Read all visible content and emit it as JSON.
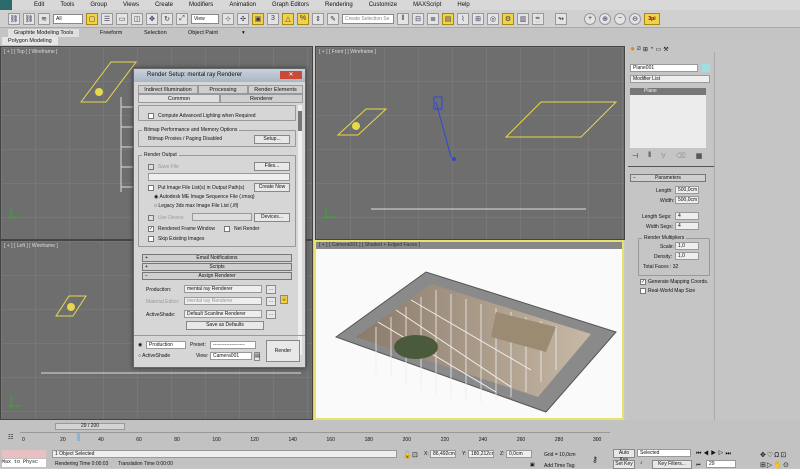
{
  "menu": [
    "Edit",
    "Tools",
    "Group",
    "Views",
    "Create",
    "Modifiers",
    "Animation",
    "Graph Editors",
    "Rendering",
    "Customize",
    "MAXScript",
    "Help"
  ],
  "toolbar": {
    "filter": "All",
    "ref_coord": "View",
    "selection_set_placeholder": "Create Selection Se",
    "logo": "3pi"
  },
  "ribbon": {
    "tabs": [
      "Graphite Modeling Tools",
      "Freeform",
      "Selection",
      "Object Paint"
    ],
    "sub": "Polygon Modeling"
  },
  "viewports": {
    "top": "[ + ] [ Top ] [ Wireframe ]",
    "front": "[ + ] [ Front ] [ Wireframe ]",
    "left": "[ + ] [ Left ] [ Wireframe ]",
    "camera": "[ + ] [ Camera001 ] [ Shaded + Edged Faces ]"
  },
  "dialog": {
    "title": "Render Setup: mental ray Renderer",
    "tabs_row1": [
      "Indirect Illumination",
      "Processing",
      "Render Elements"
    ],
    "tabs_row2": [
      "Common",
      "Renderer"
    ],
    "compute_adv_lighting": "Compute Advanced Lighting when Required",
    "bitmap_group": "Bitmap Performance and Memory Options",
    "bitmap_proxies": "Bitmap Proxies / Paging Disabled",
    "setup": "Setup...",
    "render_output": "Render Output",
    "save_file": "Save File",
    "files": "Files...",
    "put_image": "Put Image File List(s) in Output Path(s)",
    "create_now": "Create Now",
    "autodesk_me": "Autodesk ME Image Sequence File (.imsq)",
    "legacy": "Legacy 3ds max Image File List (.ifl)",
    "use_device": "Use Device",
    "devices": "Devices...",
    "rendered_frame_window": "Rendered Frame Window",
    "net_render": "Net Render",
    "skip_existing": "Skip Existing Images",
    "rollouts": [
      "Email Notifications",
      "Scripts",
      "Assign Renderer"
    ],
    "production_label": "Production:",
    "production_value": "mental ray Renderer",
    "material_label": "Material Editor:",
    "material_value": "mental ray Renderer",
    "activeshade_label": "ActiveShade:",
    "activeshade_value": "Default Scanline Renderer",
    "save_defaults": "Save as Defaults",
    "mode_production": "Production",
    "mode_activeshade": "ActiveShade",
    "preset_label": "Preset:",
    "preset_value": "-------------------",
    "view_label": "View:",
    "view_value": "Camera001",
    "render": "Render"
  },
  "command_panel": {
    "object_name": "Plane001",
    "modifier_list": "Modifier List",
    "stack_item": "Plane",
    "rollout": "Parameters",
    "length_label": "Length:",
    "length": "500,0cm",
    "width_label": "Width:",
    "width": "500,0cm",
    "length_segs_label": "Length Segs:",
    "length_segs": "4",
    "width_segs_label": "Width Segs:",
    "width_segs": "4",
    "render_mult": "Render Multipliers",
    "scale_label": "Scale:",
    "scale": "1,0",
    "density_label": "Density:",
    "density": "1,0",
    "total_faces": "Total Faces : 32",
    "gen_mapping": "Generate Mapping Coords.",
    "real_world": "Real-World Map Size",
    "color": "#9ee0e0"
  },
  "timeline": {
    "frame": "29 / 200",
    "ticks": [
      "0",
      "20",
      "40",
      "60",
      "80",
      "100",
      "120",
      "140",
      "160",
      "180",
      "200",
      "220",
      "240",
      "260",
      "280",
      "300"
    ],
    "current": 29,
    "total": 200
  },
  "status": {
    "maxscript": "Max to Physc",
    "selected": "1 Object Selected",
    "render_time": "Rendering Time  0:00:03",
    "translation_time": "Translation Time  0:00:00",
    "x": "86,492cm",
    "y": "180,212cm",
    "z": "0,0cm",
    "grid": "Grid = 10,0cm",
    "add_time_tag": "Add Time Tag",
    "auto_key": "Auto Key",
    "set_key": "Set Key",
    "key_mode": "Selected",
    "key_filters": "Key Filters...",
    "frame_field": "29"
  }
}
